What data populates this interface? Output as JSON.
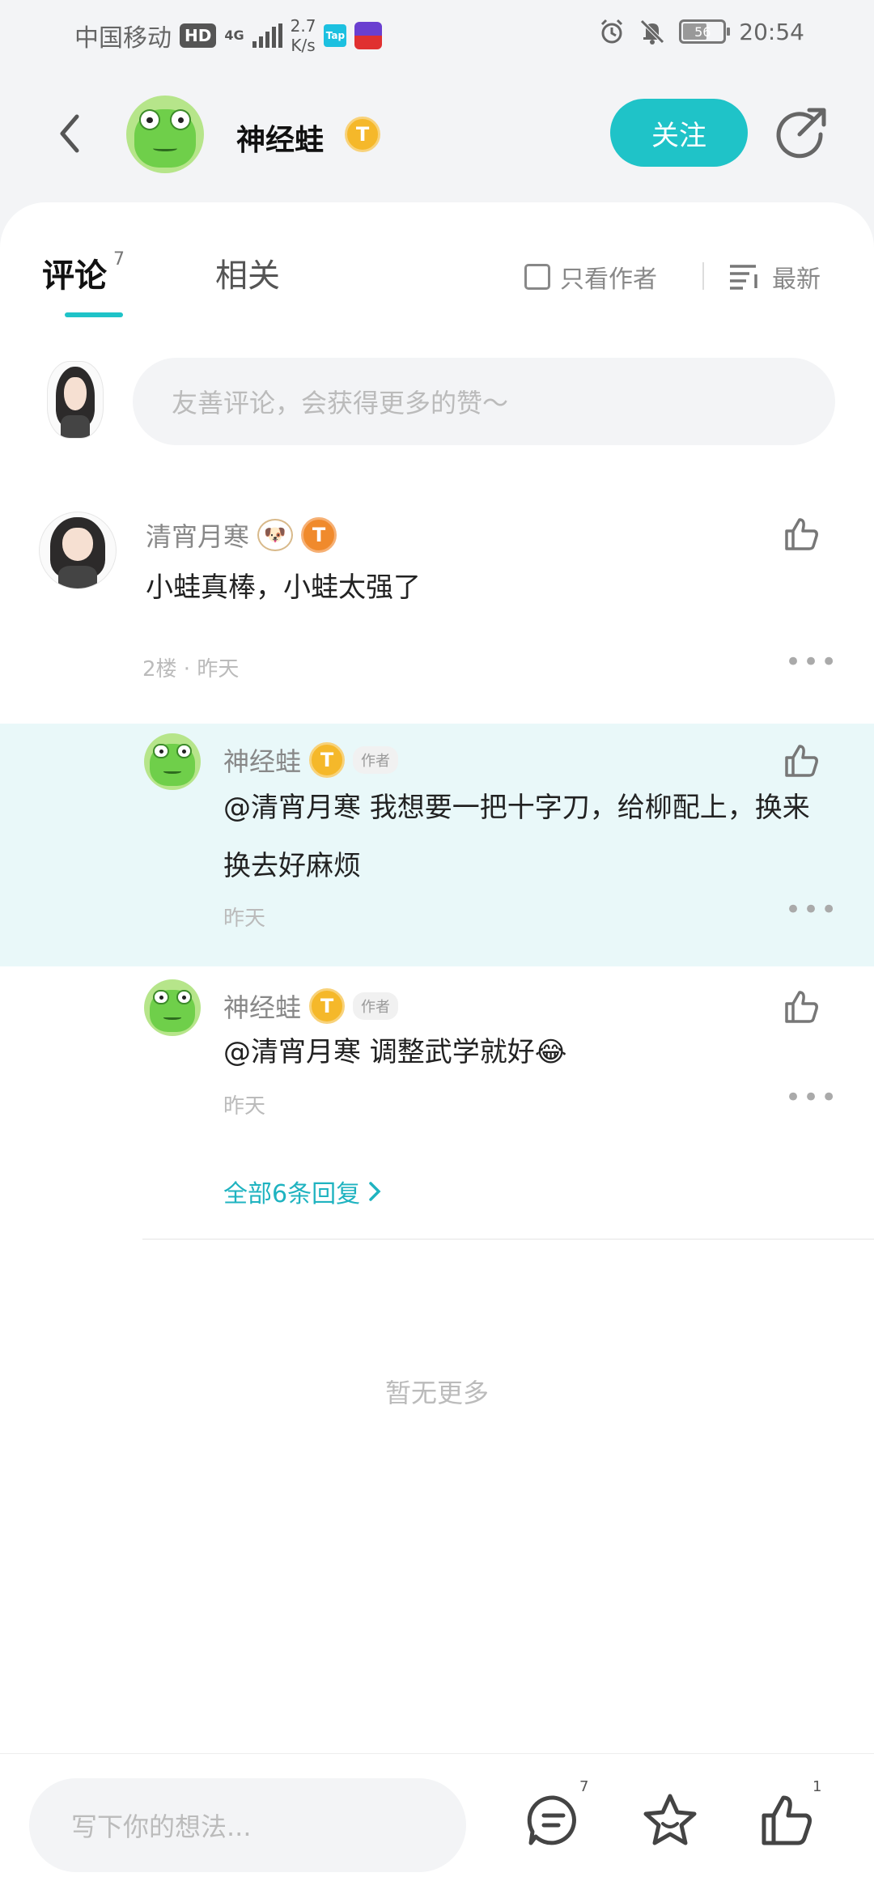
{
  "status_bar": {
    "carrier": "中国移动",
    "hd": "HD",
    "network": "4G",
    "speed_value": "2.7",
    "speed_unit": "K/s",
    "app_tap_label": "Tap",
    "battery": "56",
    "time": "20:54"
  },
  "header": {
    "username": "神经蛙",
    "level": "T",
    "follow_label": "关注"
  },
  "tabs": {
    "comments_label": "评论",
    "comments_count": "7",
    "related_label": "相关",
    "only_author_label": "只看作者",
    "sort_label": "最新"
  },
  "comment_input": {
    "placeholder": "友善评论，会获得更多的赞～"
  },
  "comments": [
    {
      "username": "清宵月寒",
      "level": "T",
      "text": "小蛙真棒，小蛙太强了",
      "meta": "2楼 · 昨天"
    }
  ],
  "replies": [
    {
      "username": "神经蛙",
      "level": "T",
      "author_tag": "作者",
      "text": "@清宵月寒 我想要一把十字刀，给柳配上，换来换去好麻烦",
      "meta": "昨天"
    },
    {
      "username": "神经蛙",
      "level": "T",
      "author_tag": "作者",
      "text": "@清宵月寒 调整武学就好😂",
      "meta": "昨天"
    }
  ],
  "view_all_replies": "全部6条回复",
  "no_more": "暂无更多",
  "bottom_bar": {
    "placeholder": "写下你的想法...",
    "comment_count": "7",
    "like_count": "1"
  },
  "colors": {
    "accent": "#1fc3c8",
    "highlight_bg": "#e9f8f9",
    "badge_gold": "#f5b82a"
  }
}
